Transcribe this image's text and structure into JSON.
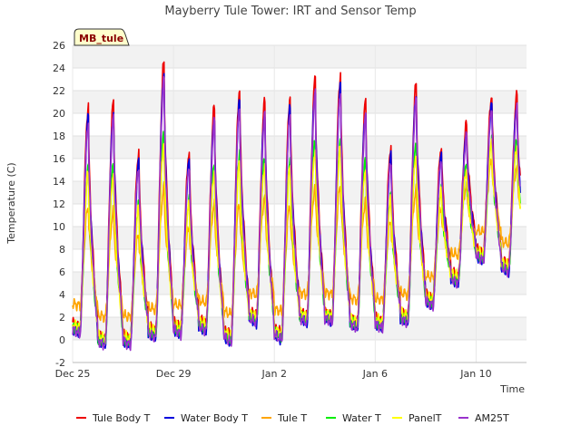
{
  "chart_data": {
    "type": "line",
    "title": "Mayberry Tule Tower: IRT and Sensor Temp",
    "xlabel": "Time",
    "ylabel": "Temperature (C)",
    "badge": "MB_tule",
    "ylim": [
      -2,
      26
    ],
    "yticks": [
      -2,
      0,
      2,
      4,
      6,
      8,
      10,
      12,
      14,
      16,
      18,
      20,
      22,
      24,
      26
    ],
    "xlim": [
      "2023-12-25",
      "2024-01-12"
    ],
    "xticks": [
      {
        "x": "2023-12-25",
        "label": "Dec 25"
      },
      {
        "x": "2023-12-29",
        "label": "Dec 29"
      },
      {
        "x": "2024-01-02",
        "label": "Jan 2"
      },
      {
        "x": "2024-01-06",
        "label": "Jan 6"
      },
      {
        "x": "2024-01-10",
        "label": "Jan 10"
      }
    ],
    "grid": true,
    "legend_position": "bottom",
    "day_start": "2023-12-25",
    "day_end": "2024-01-11",
    "daily": {
      "dates": [
        "Dec 25",
        "Dec 26",
        "Dec 27",
        "Dec 28",
        "Dec 29",
        "Dec 30",
        "Dec 31",
        "Jan 1",
        "Jan 2",
        "Jan 3",
        "Jan 4",
        "Jan 5",
        "Jan 6",
        "Jan 7",
        "Jan 8",
        "Jan 9",
        "Jan 10",
        "Jan 11"
      ],
      "min": [
        0.5,
        -0.5,
        -0.5,
        0.2,
        0.5,
        0.8,
        -0.2,
        1.5,
        0.0,
        1.5,
        1.5,
        1.0,
        1.0,
        1.5,
        3.0,
        5.0,
        7.0,
        6.0
      ],
      "max": [
        20.0,
        20.5,
        16.0,
        24.0,
        16.0,
        20.0,
        21.5,
        20.5,
        20.8,
        22.5,
        22.8,
        20.5,
        16.5,
        22.0,
        16.5,
        18.5,
        21.0,
        21.0
      ]
    },
    "series": [
      {
        "name": "Tule Body T",
        "color": "#ee0000",
        "offset": 0.6,
        "amp": 1.0
      },
      {
        "name": "Water Body T",
        "color": "#0000dd",
        "offset": 0.0,
        "amp": 0.98
      },
      {
        "name": "Tule T",
        "color": "#ffa500",
        "offset": 2.5,
        "amp": 0.45
      },
      {
        "name": "Water T",
        "color": "#00ee00",
        "offset": 0.3,
        "amp": 0.75
      },
      {
        "name": "PanelT",
        "color": "#ffff00",
        "offset": 0.6,
        "amp": 0.7
      },
      {
        "name": "AM25T",
        "color": "#9932cc",
        "offset": 0.0,
        "amp": 0.96
      }
    ]
  }
}
